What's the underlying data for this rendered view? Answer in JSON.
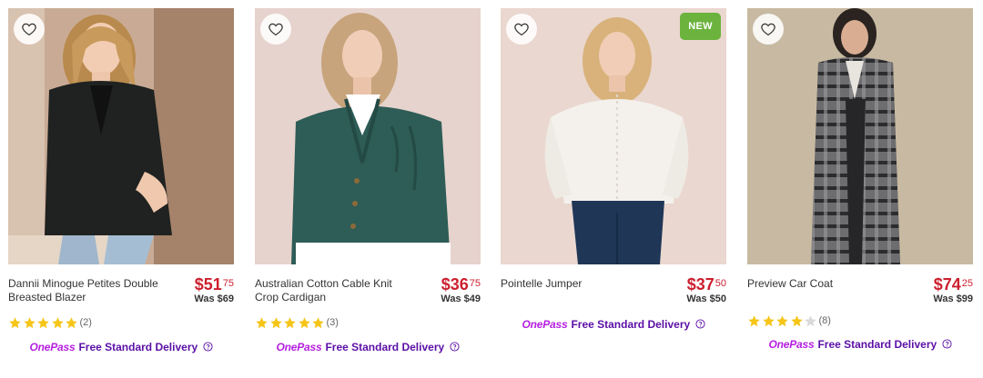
{
  "products": [
    {
      "name": "Dannii Minogue Petites Double Breasted Blazer",
      "price_dollars": "$51",
      "price_cents": "75",
      "was": "Was $69",
      "rating": 5,
      "review_count": "(2)",
      "badge": "",
      "delivery_brand": "OnePass",
      "delivery_text": "Free Standard Delivery"
    },
    {
      "name": "Australian Cotton Cable Knit Crop Cardigan",
      "price_dollars": "$36",
      "price_cents": "75",
      "was": "Was $49",
      "rating": 5,
      "review_count": "(3)",
      "badge": "",
      "delivery_brand": "OnePass",
      "delivery_text": "Free Standard Delivery"
    },
    {
      "name": "Pointelle Jumper",
      "price_dollars": "$37",
      "price_cents": "50",
      "was": "Was $50",
      "rating": null,
      "review_count": "",
      "badge": "NEW",
      "delivery_brand": "OnePass",
      "delivery_text": "Free Standard Delivery"
    },
    {
      "name": "Preview Car Coat",
      "price_dollars": "$74",
      "price_cents": "25",
      "was": "Was $99",
      "rating": 4,
      "review_count": "(8)",
      "badge": "",
      "delivery_brand": "OnePass",
      "delivery_text": "Free Standard Delivery"
    }
  ],
  "colors": {
    "price": "#cc1f2e",
    "star": "#f5c518",
    "star_empty": "#d9d9d9",
    "onepass": "#b51ee0",
    "delivery": "#5b0fa6",
    "badge_new": "#6cb33e"
  },
  "icons": {
    "wishlist": "heart-outline-icon",
    "star": "star-icon",
    "info": "question-circle-icon"
  }
}
